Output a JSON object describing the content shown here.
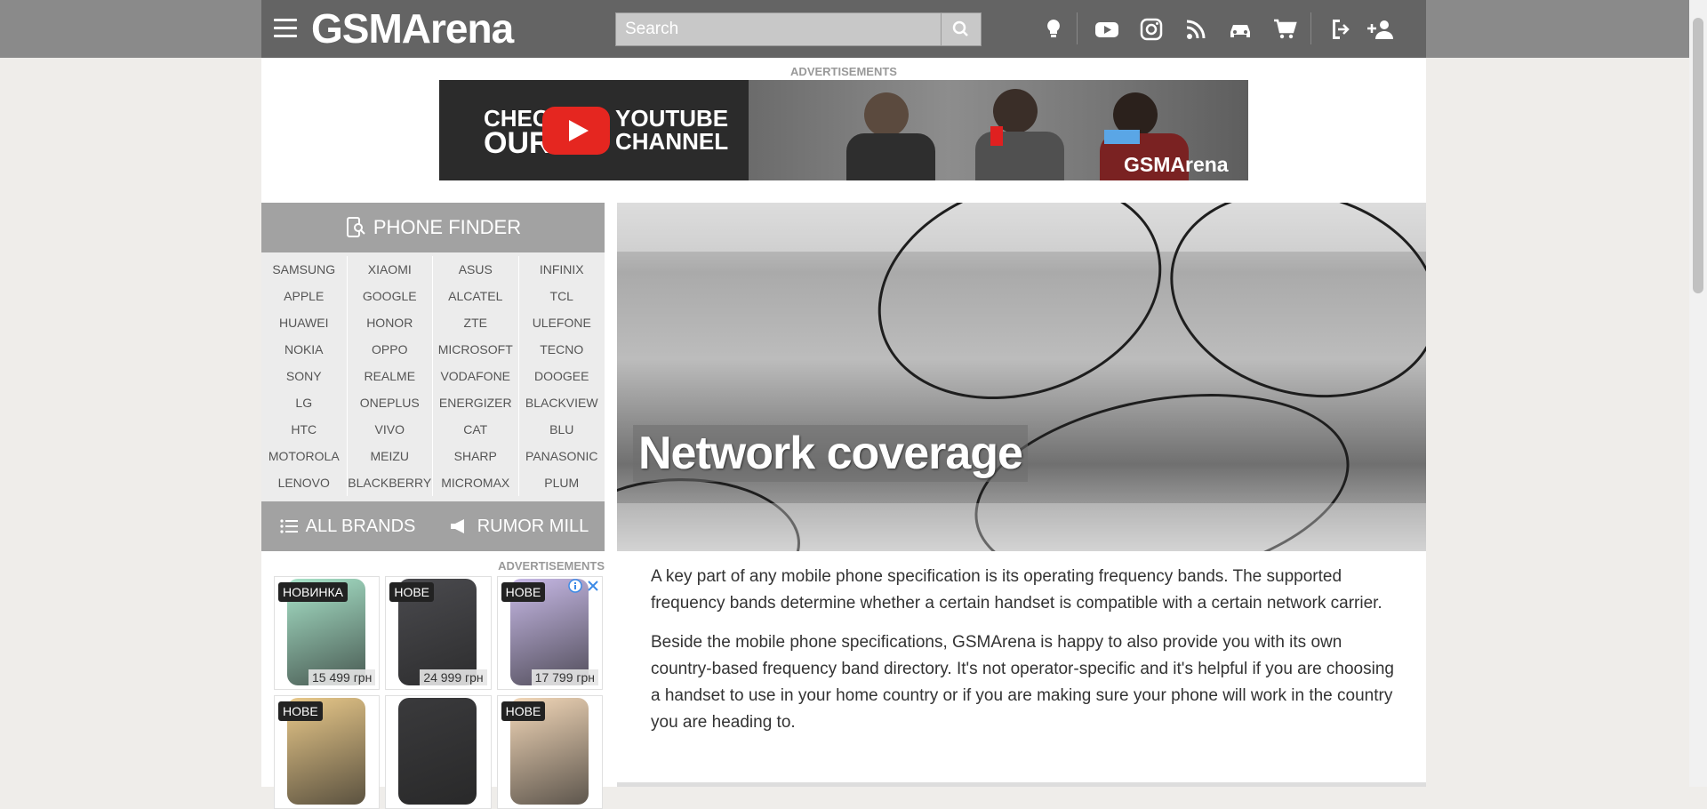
{
  "header": {
    "logo": "GSMArena",
    "search_placeholder": "Search",
    "icons": [
      "tip-icon",
      "youtube-icon",
      "instagram-icon",
      "rss-icon",
      "car-icon",
      "cart-icon",
      "login-icon",
      "signup-icon"
    ]
  },
  "top_ad": {
    "label": "ADVERTISEMENTS",
    "line1a": "CHECK",
    "line1b": "OUR",
    "line2a": "YOUTUBE",
    "line2b": "CHANNEL",
    "brand": "GSMArena"
  },
  "sidebar": {
    "finder_label": "PHONE FINDER",
    "brands": [
      "SAMSUNG",
      "XIAOMI",
      "ASUS",
      "INFINIX",
      "APPLE",
      "GOOGLE",
      "ALCATEL",
      "TCL",
      "HUAWEI",
      "HONOR",
      "ZTE",
      "ULEFONE",
      "NOKIA",
      "OPPO",
      "MICROSOFT",
      "TECNO",
      "SONY",
      "REALME",
      "VODAFONE",
      "DOOGEE",
      "LG",
      "ONEPLUS",
      "ENERGIZER",
      "BLACKVIEW",
      "HTC",
      "VIVO",
      "CAT",
      "BLU",
      "MOTOROLA",
      "MEIZU",
      "SHARP",
      "PANASONIC",
      "LENOVO",
      "BLACKBERRY",
      "MICROMAX",
      "PLUM"
    ],
    "all_brands": "ALL BRANDS",
    "rumor_mill": "RUMOR MILL",
    "ads_label": "ADVERTISEMENTS",
    "phone_ads": [
      {
        "tag": "НОВИНКА",
        "price": "15 499 грн",
        "color": "#a8e3c9"
      },
      {
        "tag": "НОВЕ",
        "price": "24 999 грн",
        "color": "#4a4a4e"
      },
      {
        "tag": "НОВЕ",
        "price": "17 799 грн",
        "color": "#c7b9e6"
      },
      {
        "tag": "НОВЕ",
        "price": "",
        "color": "#e9c98a"
      },
      {
        "tag": "",
        "price": "",
        "color": "#3a3a3c"
      },
      {
        "tag": "НОВЕ",
        "price": "",
        "color": "#f2d7b8"
      }
    ]
  },
  "hero": {
    "title": "Network coverage"
  },
  "article": {
    "p1": "A key part of any mobile phone specification is its operating frequency bands. The supported frequency bands determine whether a certain handset is compatible with a certain network carrier.",
    "p2": "Beside the mobile phone specifications, GSMArena is happy to also provide you with its own country-based frequency band directory. It's not operator-specific and it's helpful if you are choosing a handset to use in your home country or if you are making sure your phone will work in the country you are heading to."
  }
}
